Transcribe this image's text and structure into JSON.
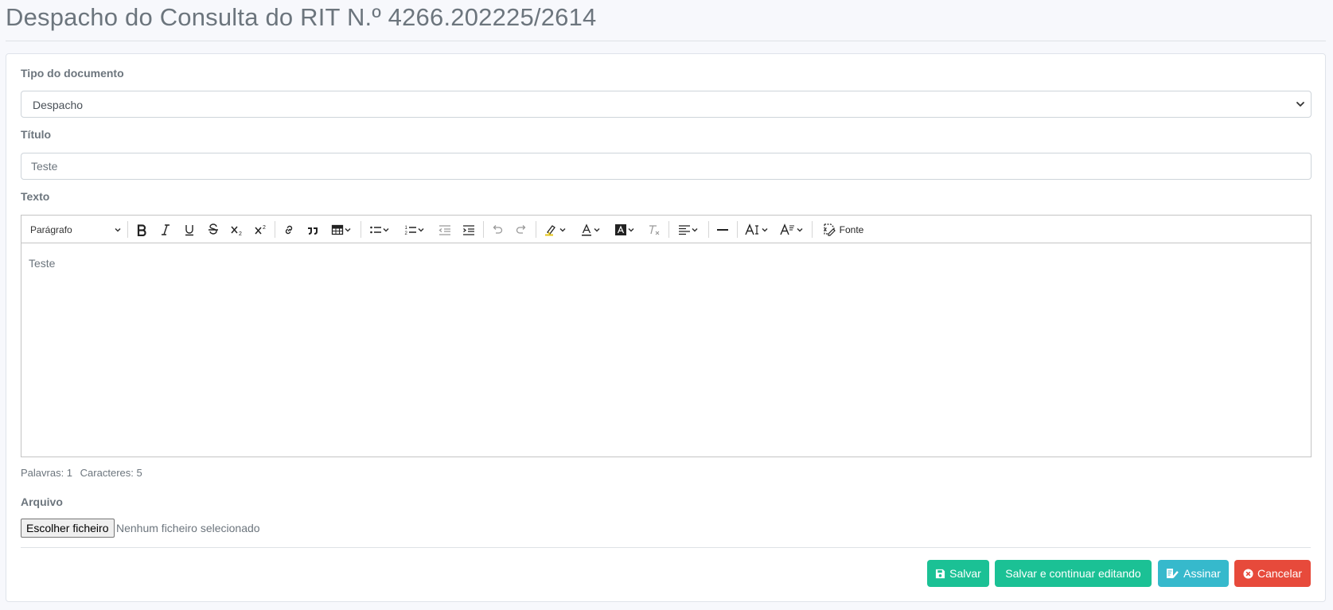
{
  "page": {
    "title": "Despacho do Consulta do RIT N.º 4266.202225/2614"
  },
  "form": {
    "doc_type_label": "Tipo do documento",
    "doc_type_value": "Despacho",
    "title_label": "Título",
    "title_value": "Teste",
    "text_label": "Texto",
    "editor": {
      "paragraph_style": "Parágrafo",
      "source_label": "Fonte",
      "content": "Teste",
      "words": "Palavras: 1",
      "chars": "Caracteres: 5"
    },
    "file_label": "Arquivo",
    "file_button": "Escolher ficheiro",
    "file_status": "Nenhum ficheiro selecionado"
  },
  "actions": {
    "save": "Salvar",
    "save_continue": "Salvar e continuar editando",
    "sign": "Assinar",
    "cancel": "Cancelar"
  },
  "colors": {
    "success": "#1bc195",
    "info": "#36b9cc",
    "danger": "#e74a3b"
  }
}
